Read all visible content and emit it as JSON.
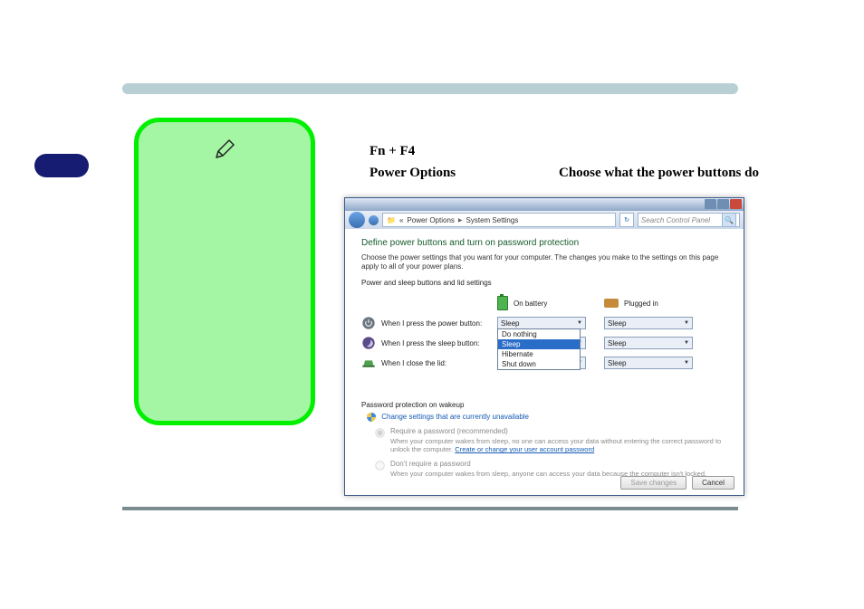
{
  "headline": {
    "fn": "Fn + F4",
    "choose": "Choose what the power buttons do",
    "po": "Power Options"
  },
  "win": {
    "crumb1": "Power Options",
    "crumb2": "System Settings",
    "search_ph": "Search Control Panel",
    "title": "Define power buttons and turn on password protection",
    "desc": "Choose the power settings that you want for your computer. The changes you make to the settings on this page apply to all of your power plans.",
    "sub": "Power and sleep buttons and lid settings",
    "col_bat": "On battery",
    "col_plug": "Plugged in",
    "row1": "When I press the power button:",
    "row2": "When I press the sleep button:",
    "row3": "When I close the lid:",
    "sleep": "Sleep",
    "dd1": "Do nothing",
    "dd2": "Sleep",
    "dd3": "Hibernate",
    "dd4": "Shut down",
    "pw_head": "Password protection on wakeup",
    "chg": "Change settings that are currently unavailable",
    "opt1": "Require a password (recommended)",
    "opt1_expl_a": "When your computer wakes from sleep, no one can access your data without entering the correct password to unlock the computer. ",
    "opt1_link": "Create or change your user account password",
    "opt2": "Don't require a password",
    "opt2_expl": "When your computer wakes from sleep, anyone can access your data because the computer isn't locked.",
    "btn_save": "Save changes",
    "btn_cancel": "Cancel"
  }
}
